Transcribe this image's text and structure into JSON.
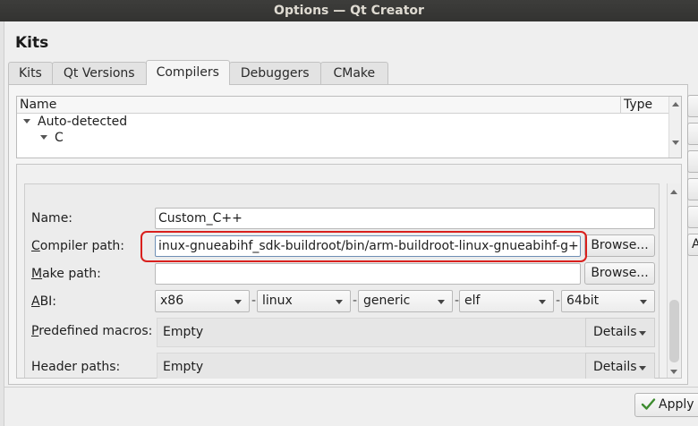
{
  "window": {
    "title": "Options — Qt Creator"
  },
  "page": {
    "title": "Kits"
  },
  "tabs": [
    {
      "label": "Kits",
      "active": false
    },
    {
      "label": "Qt Versions",
      "active": false
    },
    {
      "label": "Compilers",
      "active": true
    },
    {
      "label": "Debuggers",
      "active": false
    },
    {
      "label": "CMake",
      "active": false
    }
  ],
  "tree": {
    "columns": {
      "name": "Name",
      "type": "Type"
    },
    "rows": [
      {
        "label": "Auto-detected",
        "expanded": true
      },
      {
        "label": "C",
        "expanded": true
      }
    ]
  },
  "form": {
    "name": {
      "label": "Name:",
      "value": "Custom_C++"
    },
    "compiler_path": {
      "label_pre": "",
      "label_mnemonic": "C",
      "label_post": "ompiler path:",
      "value": "inux-gnueabihf_sdk-buildroot/bin/arm-buildroot-linux-gnueabihf-g++",
      "browse_label": "Browse..."
    },
    "make_path": {
      "label_mnemonic": "M",
      "label_post": "ake path:",
      "value": "",
      "browse_label": "Browse..."
    },
    "abi": {
      "label_mnemonic": "A",
      "label_post": "BI:",
      "parts": [
        "x86",
        "linux",
        "generic",
        "elf",
        "64bit"
      ],
      "separator": "-"
    },
    "predefined_macros": {
      "label_mnemonic": "P",
      "label_post": "redefined macros:",
      "value": "Empty",
      "details_label": "Details"
    },
    "header_paths": {
      "label_mnemonic": "",
      "label_post": "Header paths:",
      "value": "Empty",
      "details_label": "Details"
    }
  },
  "right_buttons": [
    {
      "label": ""
    },
    {
      "label": ""
    },
    {
      "label": ""
    },
    {
      "label": ""
    },
    {
      "label": ""
    },
    {
      "label": "A"
    }
  ],
  "footer": {
    "apply_label": "Apply"
  },
  "colors": {
    "highlight": "#d9201d",
    "titlebar": "#3a3a38",
    "apply_check": "#3d8b2f"
  }
}
